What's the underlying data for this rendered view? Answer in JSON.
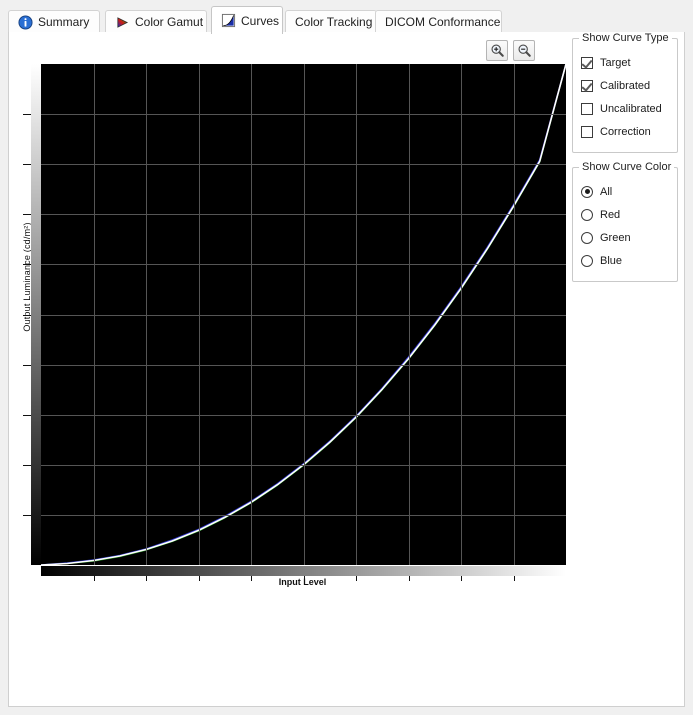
{
  "window": {
    "background": "#f0f0f0",
    "panel_background": "#ffffff"
  },
  "tabs": [
    {
      "label": "Summary",
      "icon": "info-icon",
      "selected": false
    },
    {
      "label": "Color Gamut",
      "icon": "gamut-triangle-icon",
      "selected": false
    },
    {
      "label": "Curves",
      "icon": "curve-graph-icon",
      "selected": true
    },
    {
      "label": "Color Tracking",
      "icon": "none",
      "selected": false
    },
    {
      "label": "DICOM Conformance",
      "icon": "none",
      "selected": false
    }
  ],
  "toolbar": {
    "zoom_in": {
      "label": "Zoom In",
      "icon": "zoom-in-icon"
    },
    "zoom_out": {
      "label": "Zoom Out",
      "icon": "zoom-out-icon"
    }
  },
  "options": {
    "curve_type": {
      "title": "Show Curve Type",
      "items": [
        {
          "label": "Target",
          "checked": true
        },
        {
          "label": "Calibrated",
          "checked": true
        },
        {
          "label": "Uncalibrated",
          "checked": false
        },
        {
          "label": "Correction",
          "checked": false
        }
      ]
    },
    "curve_color": {
      "title": "Show Curve Color",
      "selected": "All",
      "items": [
        {
          "label": "All",
          "selected": true
        },
        {
          "label": "Red",
          "selected": false
        },
        {
          "label": "Green",
          "selected": false
        },
        {
          "label": "Blue",
          "selected": false
        }
      ]
    }
  },
  "chart_data": {
    "type": "line",
    "title": "",
    "xlabel": "Input Level",
    "ylabel": "Output Luminance (cd/m²)",
    "xlim": [
      0,
      255
    ],
    "ylim": [
      0,
      1
    ],
    "grid": true,
    "grid_color": "#555555",
    "plot_background": "#000000",
    "x_gradient": [
      "#000000",
      "#ffffff"
    ],
    "y_gradient": [
      "#ffffff",
      "#000000"
    ],
    "x_gridlines": 9,
    "y_gridlines": 9,
    "legend": "none",
    "x_normalized": [
      0,
      0.05,
      0.1,
      0.15,
      0.2,
      0.25,
      0.3,
      0.35,
      0.4,
      0.45,
      0.5,
      0.55,
      0.6,
      0.65,
      0.7,
      0.75,
      0.8,
      0.85,
      0.9,
      0.95,
      1.0
    ],
    "series": [
      {
        "name": "Target",
        "color": "#ffffff",
        "values": [
          0.0,
          0.003,
          0.009,
          0.018,
          0.031,
          0.048,
          0.069,
          0.095,
          0.125,
          0.16,
          0.2,
          0.245,
          0.295,
          0.351,
          0.412,
          0.479,
          0.552,
          0.631,
          0.716,
          0.806,
          1.0
        ]
      },
      {
        "name": "Calibrated Red",
        "color": "#d02020",
        "values": [
          0.0,
          0.003,
          0.009,
          0.018,
          0.031,
          0.049,
          0.07,
          0.096,
          0.126,
          0.161,
          0.201,
          0.246,
          0.296,
          0.352,
          0.414,
          0.481,
          0.554,
          0.633,
          0.718,
          0.808,
          1.0
        ]
      },
      {
        "name": "Calibrated Green",
        "color": "#20a020",
        "values": [
          0.0,
          0.003,
          0.008,
          0.017,
          0.03,
          0.047,
          0.068,
          0.094,
          0.124,
          0.159,
          0.199,
          0.244,
          0.294,
          0.35,
          0.411,
          0.478,
          0.551,
          0.63,
          0.715,
          0.805,
          1.0
        ]
      },
      {
        "name": "Calibrated Blue",
        "color": "#3040e0",
        "values": [
          0.0,
          0.004,
          0.01,
          0.019,
          0.032,
          0.05,
          0.071,
          0.097,
          0.127,
          0.162,
          0.202,
          0.247,
          0.297,
          0.353,
          0.415,
          0.482,
          0.555,
          0.634,
          0.719,
          0.809,
          1.0
        ]
      }
    ]
  }
}
